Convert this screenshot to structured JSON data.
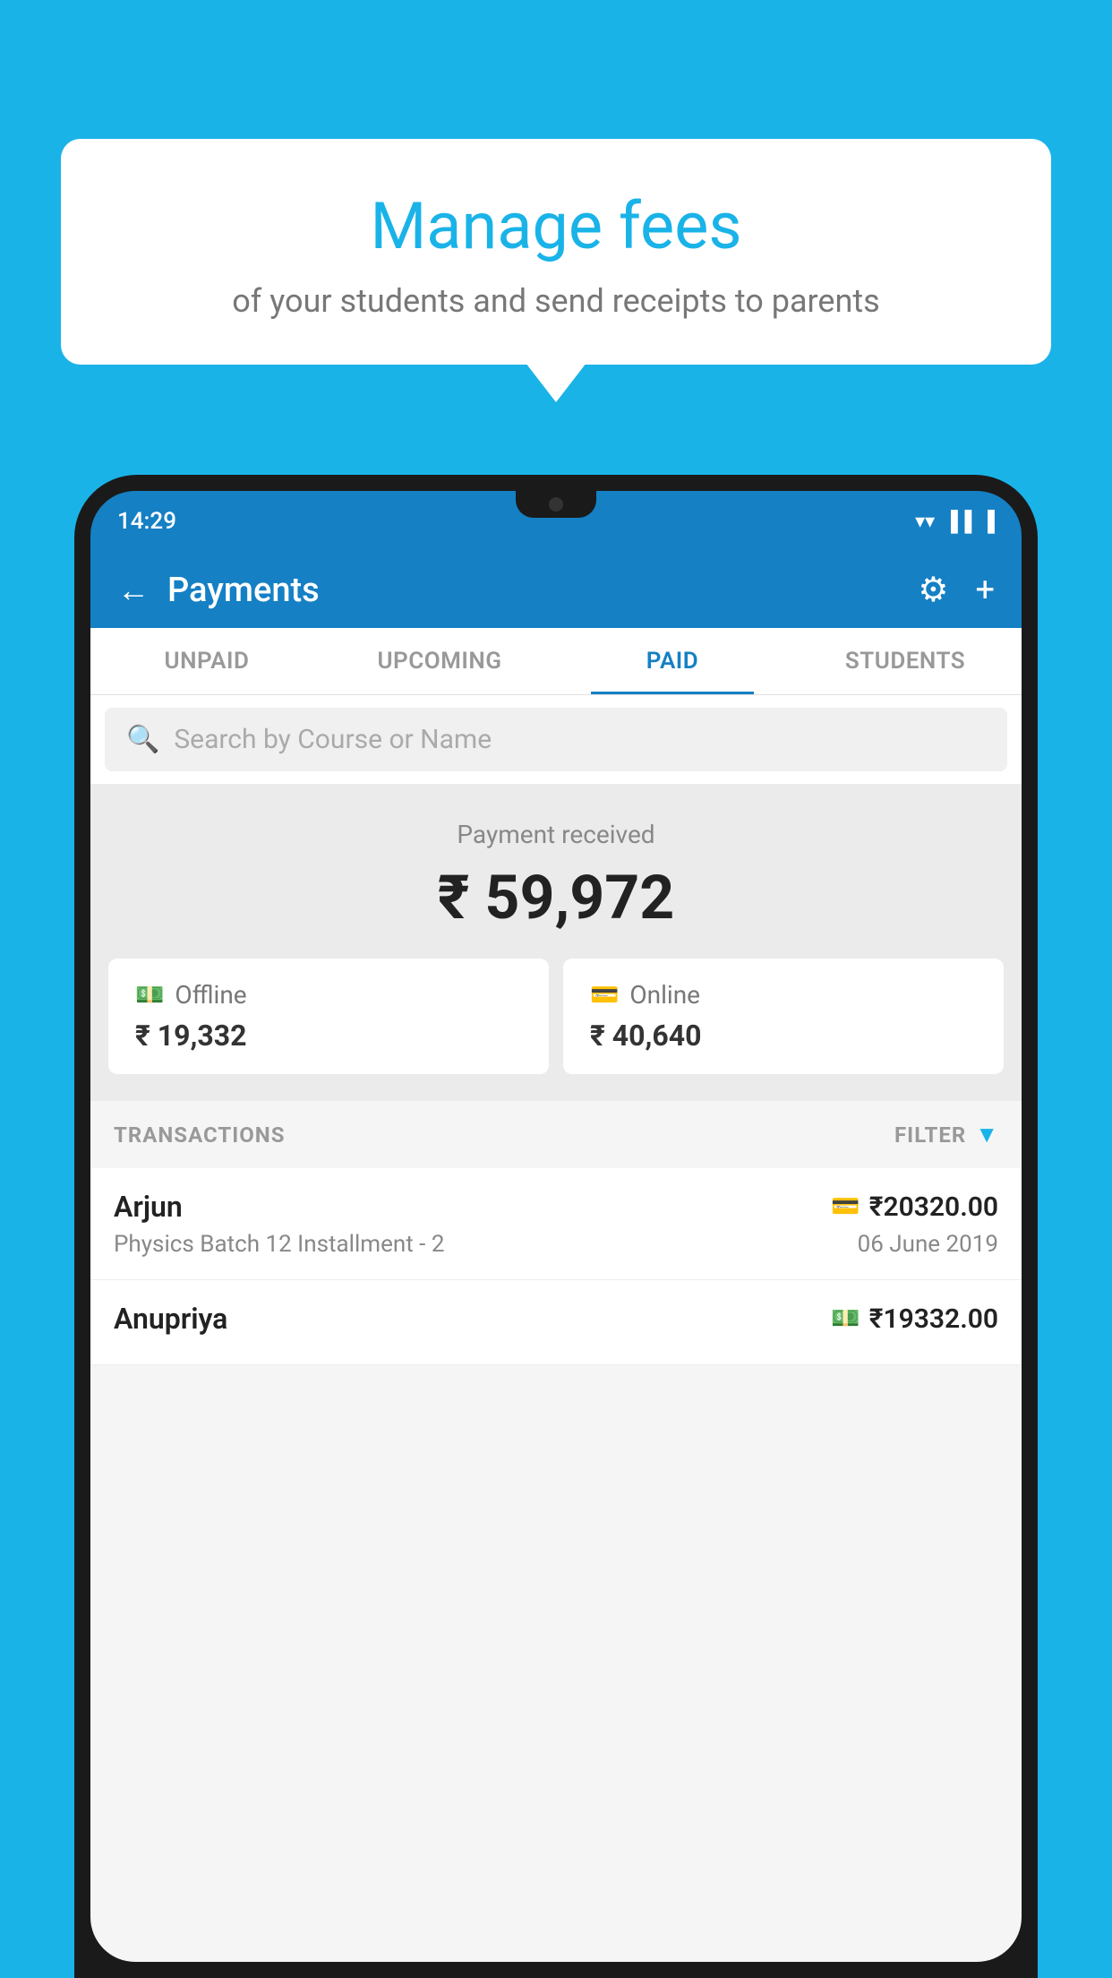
{
  "background_color": "#1ab3e8",
  "speech_bubble": {
    "title": "Manage fees",
    "subtitle": "of your students and send receipts to parents"
  },
  "status_bar": {
    "time": "14:29",
    "wifi": "▼",
    "signal": "▲",
    "battery": "▐"
  },
  "header": {
    "title": "Payments",
    "back_label": "←",
    "settings_label": "⚙",
    "add_label": "+"
  },
  "tabs": [
    {
      "label": "UNPAID",
      "active": false
    },
    {
      "label": "UPCOMING",
      "active": false
    },
    {
      "label": "PAID",
      "active": true
    },
    {
      "label": "STUDENTS",
      "active": false
    }
  ],
  "search": {
    "placeholder": "Search by Course or Name"
  },
  "payment_summary": {
    "label": "Payment received",
    "total_amount": "₹ 59,972",
    "offline": {
      "label": "Offline",
      "amount": "₹ 19,332"
    },
    "online": {
      "label": "Online",
      "amount": "₹ 40,640"
    }
  },
  "transactions_section": {
    "label": "TRANSACTIONS",
    "filter_label": "FILTER"
  },
  "transactions": [
    {
      "name": "Arjun",
      "amount": "₹20320.00",
      "course": "Physics Batch 12 Installment - 2",
      "date": "06 June 2019",
      "payment_mode": "card"
    },
    {
      "name": "Anupriya",
      "amount": "₹19332.00",
      "course": "",
      "date": "",
      "payment_mode": "offline"
    }
  ]
}
